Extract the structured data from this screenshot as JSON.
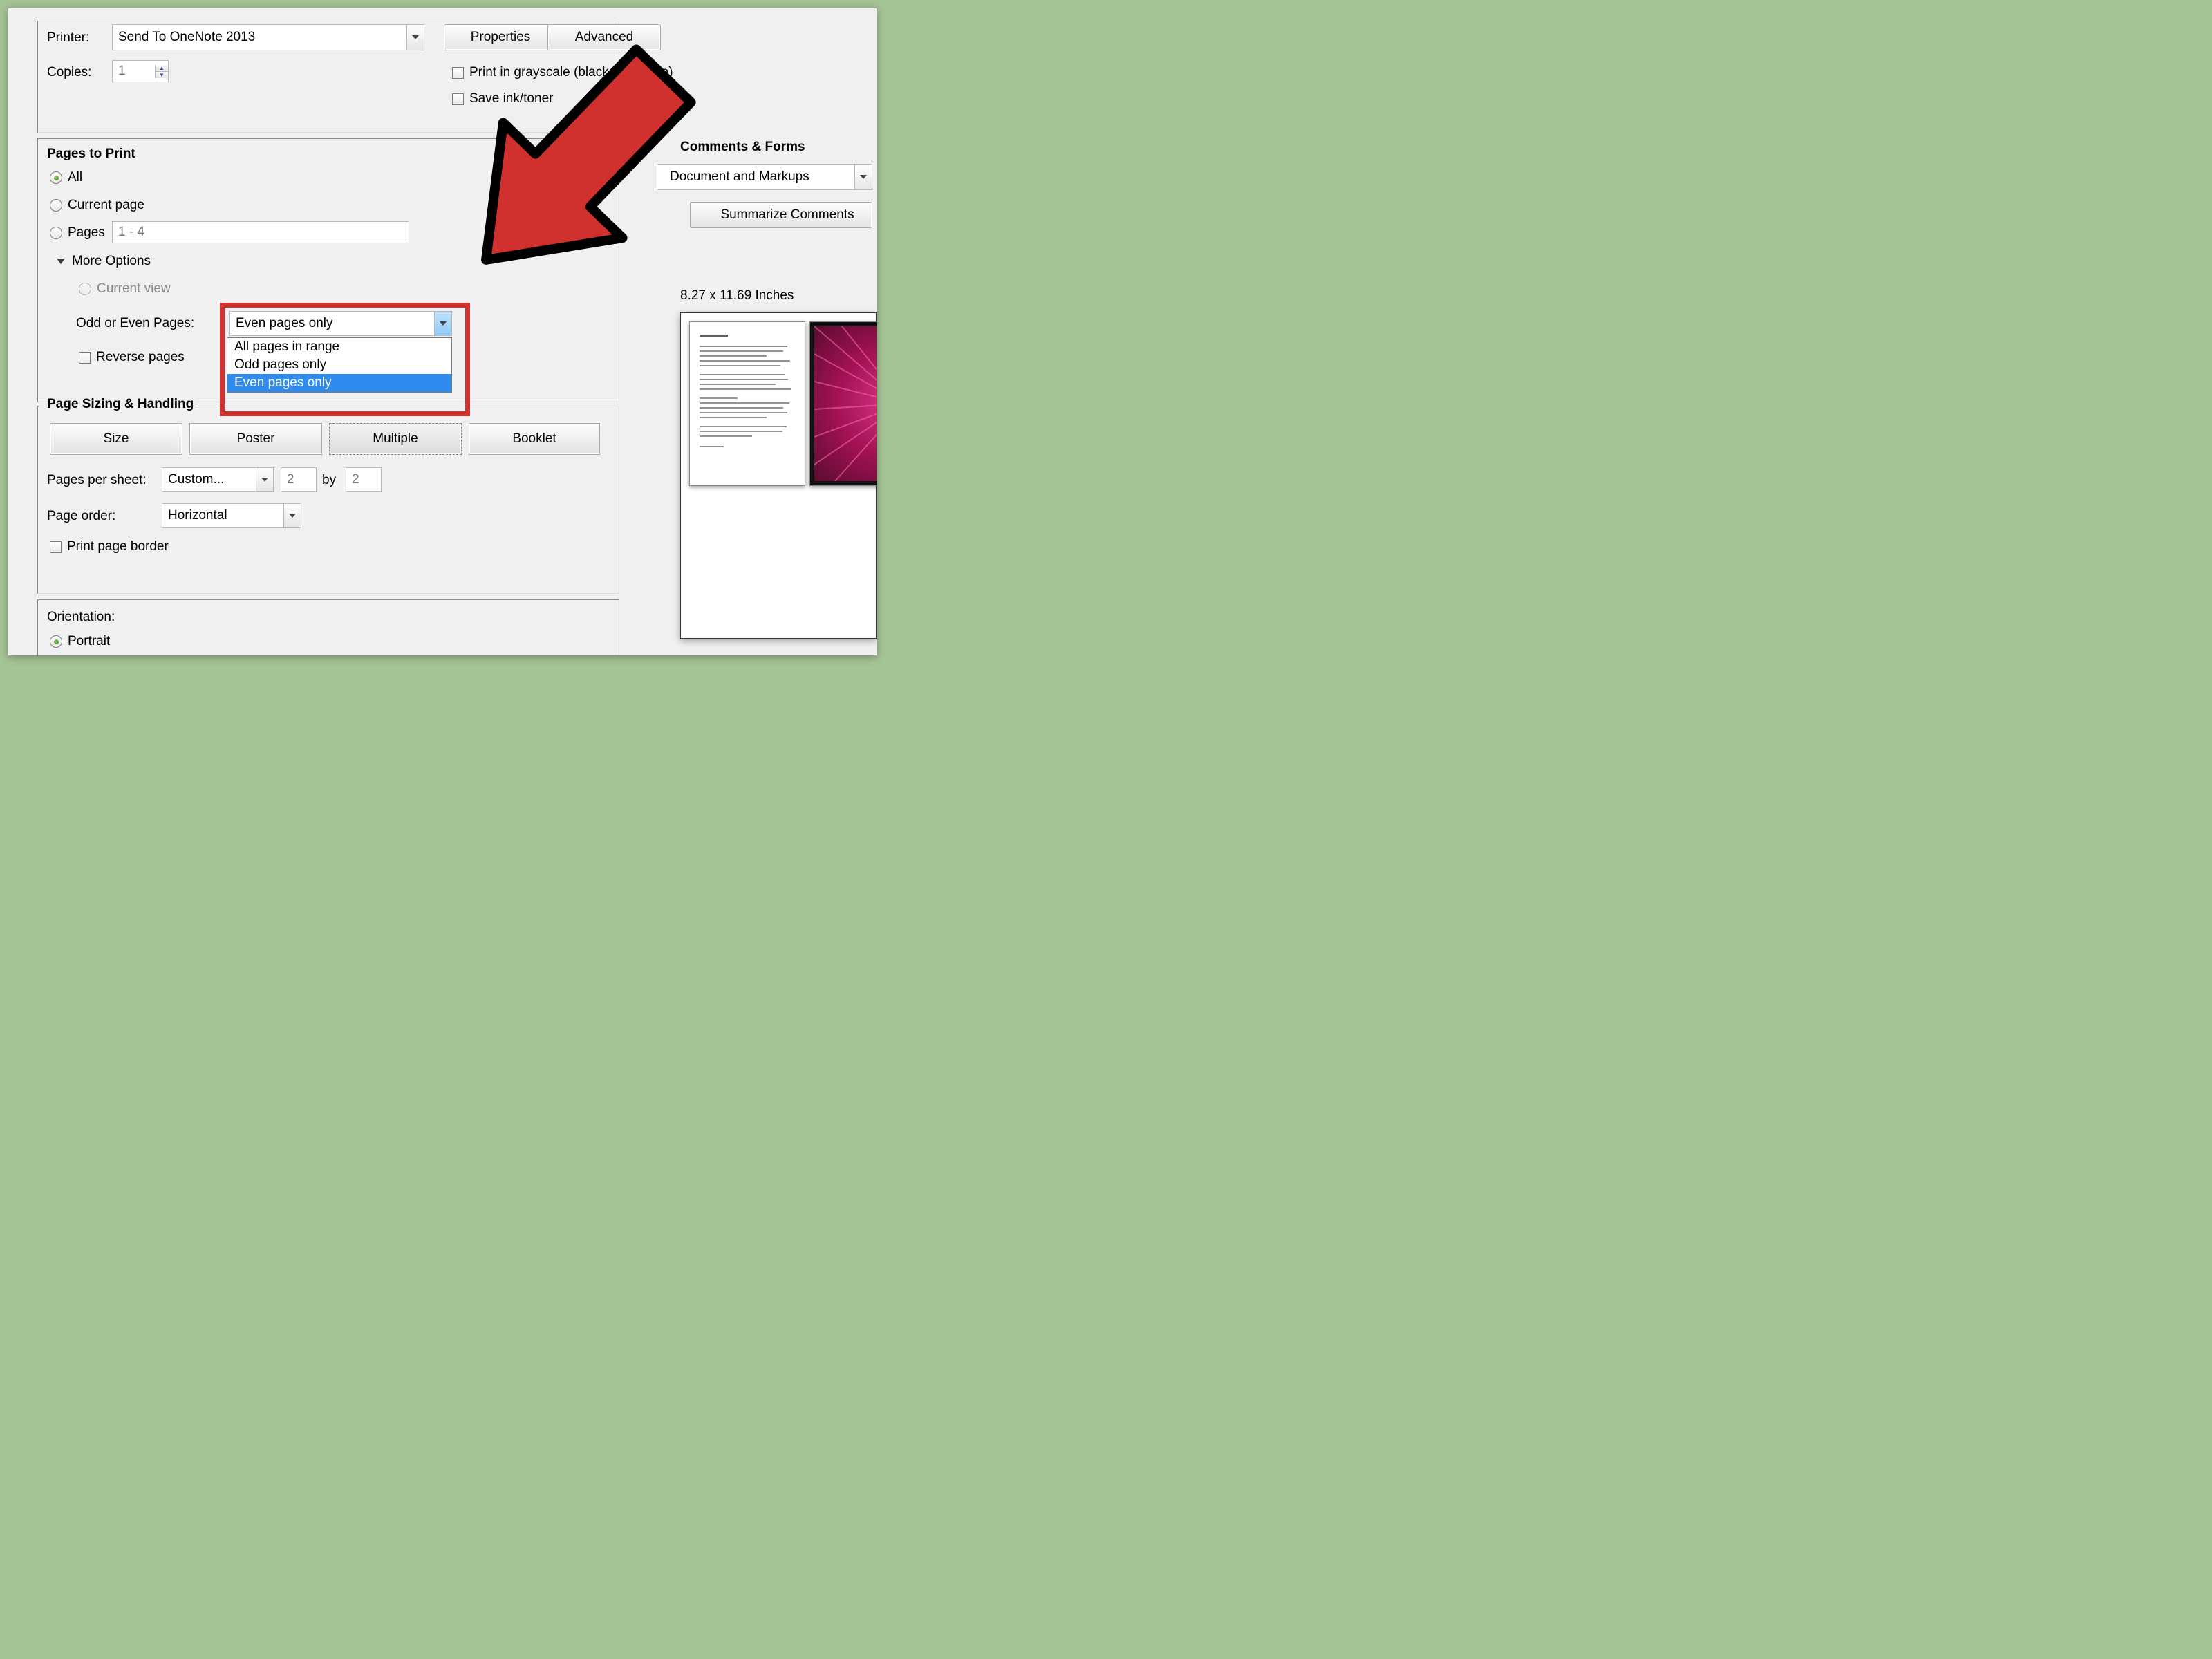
{
  "printerRow": {
    "label": "Printer:",
    "selected": "Send To OneNote 2013",
    "propertiesBtn": "Properties",
    "advancedBtn": "Advanced"
  },
  "copiesRow": {
    "label": "Copies:",
    "value": "1"
  },
  "optionsRight": {
    "grayscale": "Print in grayscale (black and white)",
    "saveInk": "Save ink/toner"
  },
  "commentsForms": {
    "heading": "Comments & Forms",
    "selected": "Document and Markups",
    "summarizeBtn": "Summarize Comments"
  },
  "pagesToPrint": {
    "heading": "Pages to Print",
    "all": "All",
    "currentPage": "Current page",
    "pagesLabel": "Pages",
    "pagesValue": "1 - 4",
    "moreOptions": "More Options",
    "currentView": "Current view",
    "oddEvenLabel": "Odd or Even Pages:",
    "oddEvenSelected": "Even pages only",
    "oddEvenOptions": [
      "All pages in range",
      "Odd pages only",
      "Even pages only"
    ],
    "reversePages": "Reverse pages"
  },
  "sizing": {
    "heading": "Page Sizing & Handling",
    "sizeBtn": "Size",
    "posterBtn": "Poster",
    "multipleBtn": "Multiple",
    "bookletBtn": "Booklet",
    "pagesPerSheetLabel": "Pages per sheet:",
    "pagesPerSheetValue": "Custom...",
    "gridX": "2",
    "gridBy": "by",
    "gridY": "2",
    "pageOrderLabel": "Page order:",
    "pageOrderValue": "Horizontal",
    "printBorder": "Print page border"
  },
  "orientation": {
    "heading": "Orientation:",
    "portrait": "Portrait"
  },
  "preview": {
    "dimensions": "8.27 x 11.69 Inches"
  }
}
